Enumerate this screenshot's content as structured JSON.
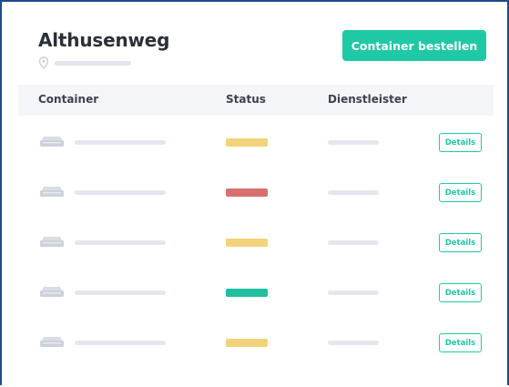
{
  "page": {
    "title": "Althusenweg",
    "order_button": "Container bestellen"
  },
  "colors": {
    "accent": "#1fc9a5",
    "status_warning": "#f2d27a",
    "status_error": "#d97070",
    "status_ok": "#1fbfa0"
  },
  "table": {
    "columns": [
      "Container",
      "Status",
      "Dienstleister"
    ],
    "rows": [
      {
        "status_color": "#f2d27a",
        "status_icon": "status-pending",
        "action": "Details"
      },
      {
        "status_color": "#d97070",
        "status_icon": "status-error",
        "action": "Details"
      },
      {
        "status_color": "#f2d27a",
        "status_icon": "status-pending",
        "action": "Details"
      },
      {
        "status_color": "#1fbfa0",
        "status_icon": "status-ok",
        "action": "Details"
      },
      {
        "status_color": "#f2d27a",
        "status_icon": "status-pending",
        "action": "Details"
      }
    ]
  },
  "icons": {
    "location": "location-pin-icon",
    "container": "container-icon"
  }
}
